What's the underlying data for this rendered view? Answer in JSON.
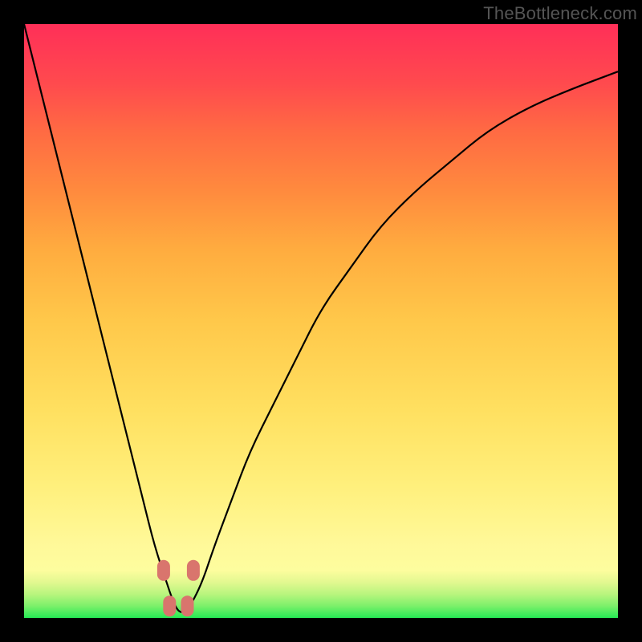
{
  "attribution": "TheBottleneck.com",
  "chart_data": {
    "type": "line",
    "title": "",
    "xlabel": "",
    "ylabel": "",
    "xlim": [
      0,
      100
    ],
    "ylim": [
      0,
      100
    ],
    "x": [
      0,
      3,
      6,
      9,
      12,
      15,
      18,
      20,
      22,
      24,
      25,
      26,
      27,
      28,
      30,
      32,
      35,
      38,
      42,
      46,
      50,
      55,
      60,
      66,
      72,
      78,
      85,
      92,
      100
    ],
    "values": [
      100,
      88,
      76,
      64,
      52,
      40,
      28,
      20,
      12,
      6,
      3,
      1,
      1,
      2,
      6,
      12,
      20,
      28,
      36,
      44,
      52,
      59,
      66,
      72,
      77,
      82,
      86,
      89,
      92
    ],
    "highlighted_points": [
      {
        "x": 23.5,
        "y": 8
      },
      {
        "x": 28.5,
        "y": 8
      },
      {
        "x": 24.5,
        "y": 2
      },
      {
        "x": 27.5,
        "y": 2
      }
    ],
    "gradient_stops": [
      {
        "pct": 0,
        "color": "#25ea55"
      },
      {
        "pct": 8,
        "color": "#fdfd9e"
      },
      {
        "pct": 50,
        "color": "#ffc84a"
      },
      {
        "pct": 100,
        "color": "#ff2f58"
      }
    ]
  }
}
